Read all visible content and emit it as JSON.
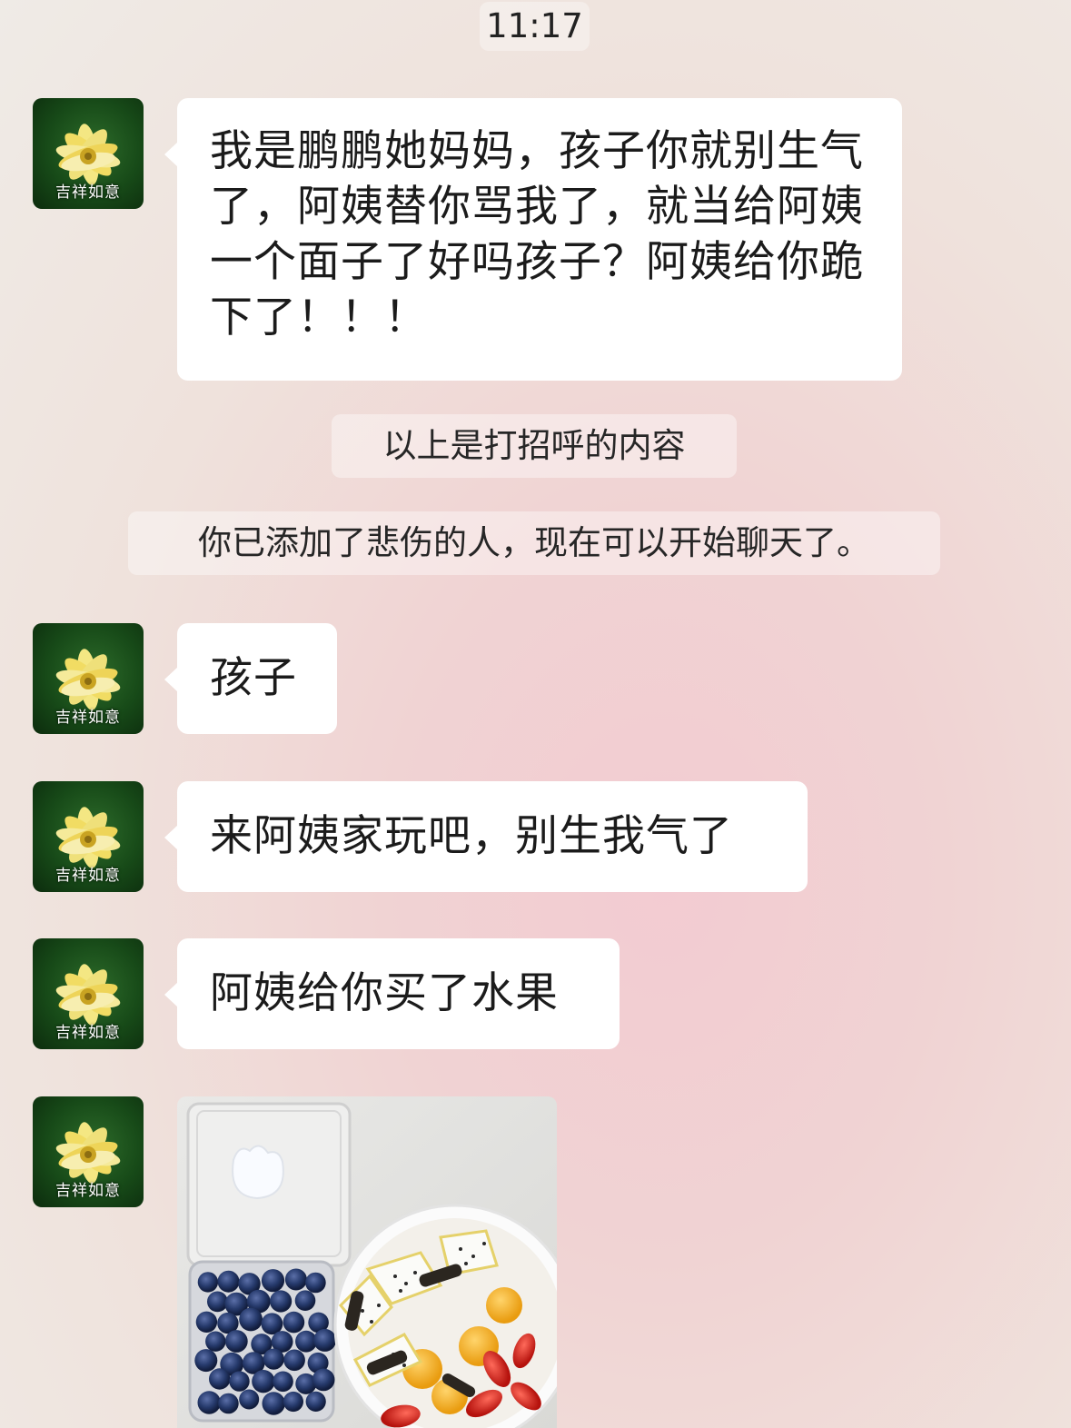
{
  "chat": {
    "time": "11:17",
    "avatar_caption": "吉祥如意",
    "messages": [
      {
        "text": "我是鹏鹏她妈妈，孩子你就别生气了，阿姨替你骂我了，就当给阿姨一个面子了好吗孩子？阿姨给你跪下了！！！"
      },
      {
        "text": "孩子"
      },
      {
        "text": "来阿姨家玩吧，别生我气了"
      },
      {
        "text": "阿姨给你买了水果"
      }
    ],
    "system_notes": [
      "以上是打招呼的内容",
      "你已添加了悲伤的人，现在可以开始聊天了。"
    ],
    "image_message": {
      "content": "fruit-photo"
    }
  },
  "colors": {
    "bubble": "#ffffff",
    "text": "#1b1b1b",
    "avatar_bg": "#174a18",
    "flower": "#f2df6e"
  }
}
